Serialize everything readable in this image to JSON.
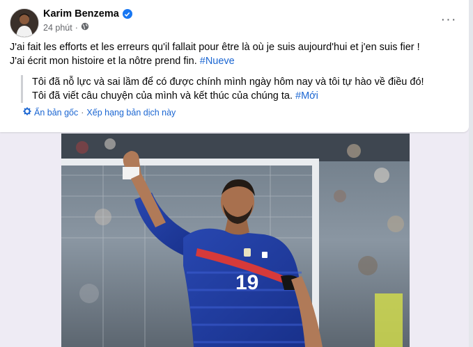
{
  "post": {
    "author": "Karim Benzema",
    "time": "24 phút",
    "more_icon": "ellipsis-icon",
    "text_line1": "J'ai fait les efforts et les erreurs qu'il fallait pour être là où je suis aujourd'hui et j'en suis fier !",
    "text_line2": "J'ai écrit mon histoire et la nôtre prend fin. ",
    "hashtag": "#Nueve",
    "translation_line1": "Tôi đã nỗ lực và sai lầm để có được chính mình ngày hôm nay và tôi tự hào về điều đó!",
    "translation_line2": "Tôi đã viết câu chuyện của mình và kết thúc của chúng ta. ",
    "translation_hashtag": "#Mới",
    "hide_original": "Ẩn bản gốc",
    "separator": "·",
    "rate_translation": "Xếp hạng bản dịch này",
    "jersey_number": "19"
  },
  "colors": {
    "link": "#1b66d2",
    "verified": "#1877f2",
    "jersey": "#1e3a9a"
  }
}
